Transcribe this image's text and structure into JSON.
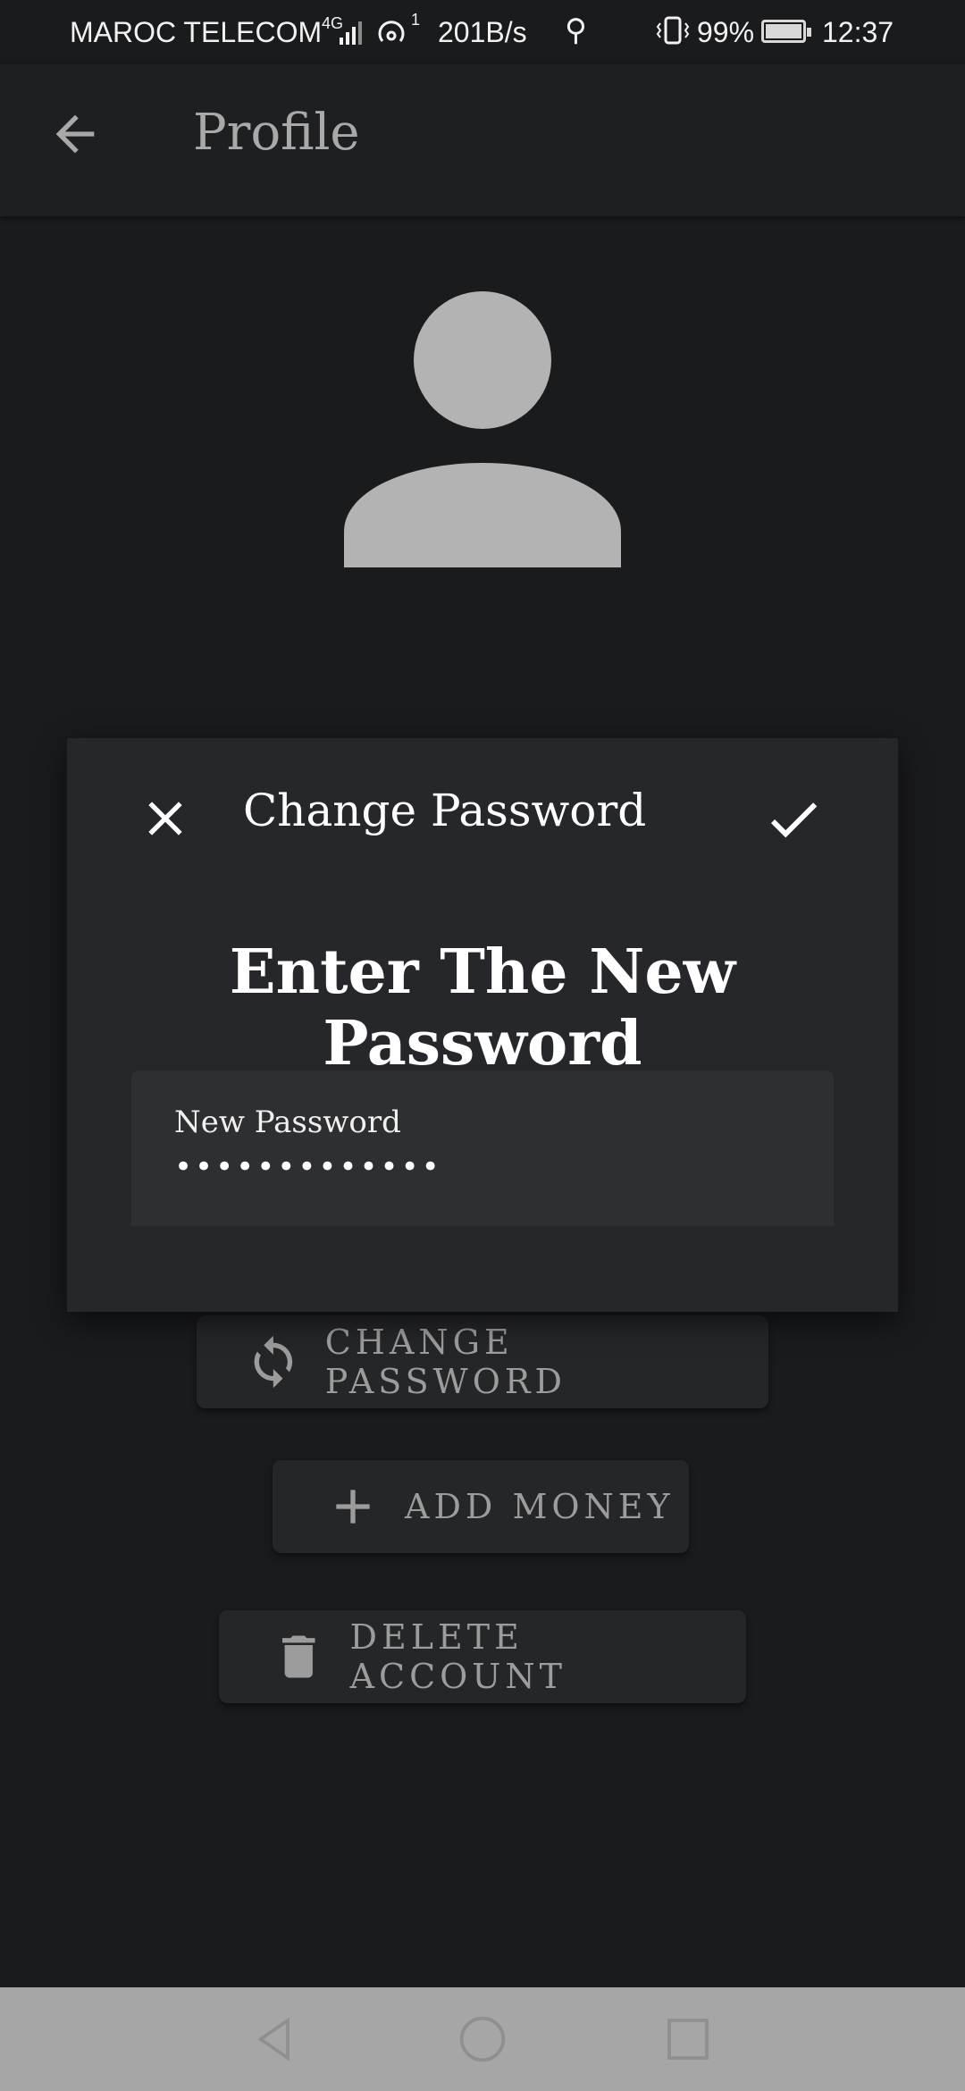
{
  "status_bar": {
    "carrier": "MAROC TELECOM",
    "network": "4G",
    "hotspot_count": "1",
    "speed": "201B/s",
    "battery": "99%",
    "time": "12:37"
  },
  "app_bar": {
    "title": "Profile",
    "back_icon": "arrow-left-icon"
  },
  "actions": {
    "change_password": "CHANGE PASSWORD",
    "add_money": "ADD MONEY",
    "delete_account": "DELETE ACCOUNT"
  },
  "dialog": {
    "title": "Change Password",
    "heading": "Enter The New Password",
    "field_label": "New Password",
    "field_value": "•••••••••••••"
  },
  "colors": {
    "background": "#1a1b1d",
    "dialog": "#26272a",
    "button": "#252628",
    "muted_text": "#9c9c9c",
    "avatar": "#b3b3b3",
    "nav_bar": "#a6a6a6"
  }
}
